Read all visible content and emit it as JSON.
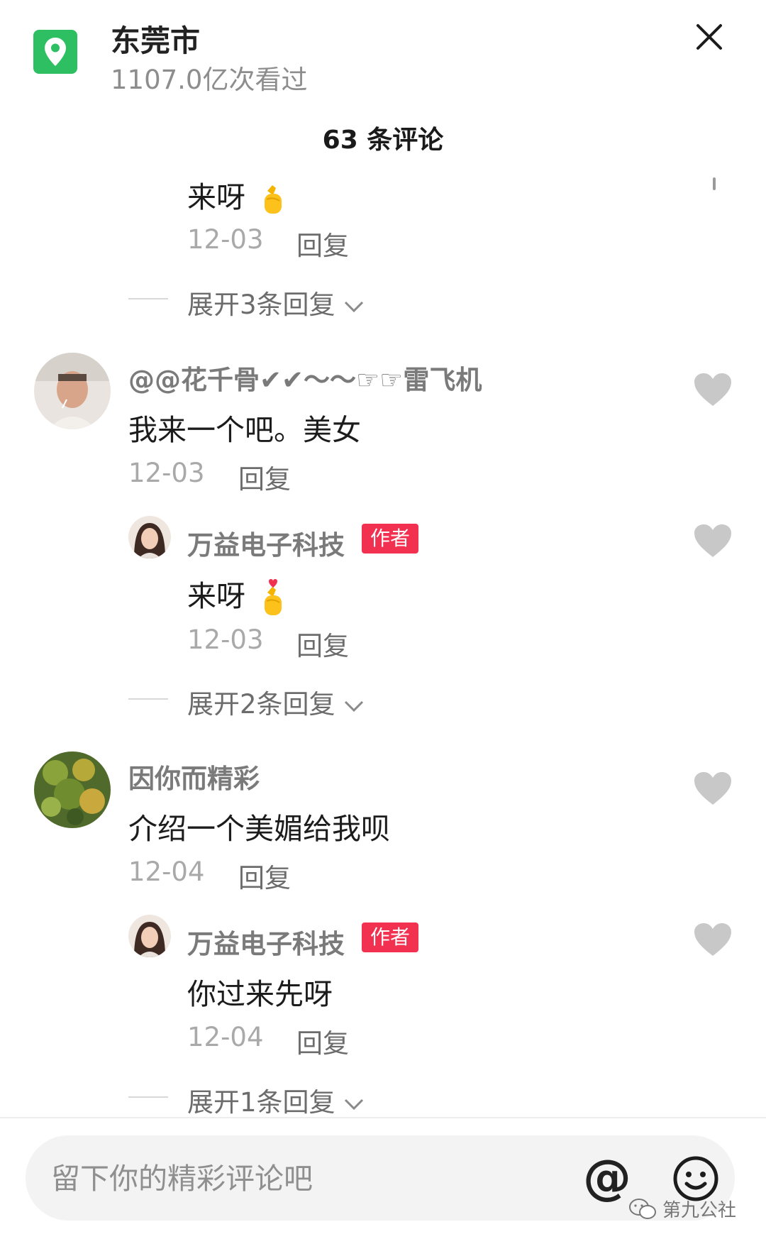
{
  "header": {
    "location_icon": "location-pin-icon",
    "location_name": "东莞市",
    "views": "1107.0亿次看过",
    "close_icon": "close-icon"
  },
  "comment_count": "63 条评论",
  "comments": [
    {
      "type": "reply",
      "text": "来呀",
      "emoji": "finger-heart-emoji",
      "date": "12-03",
      "reply_label": "回复",
      "expand_label": "展开3条回复"
    },
    {
      "type": "top",
      "username": "@@花千骨✔✔～～☞☞雷飞机",
      "text": "我来一个吧。美女",
      "date": "12-03",
      "reply_label": "回复"
    },
    {
      "type": "reply",
      "username": "万益电子科技",
      "badge": "作者",
      "text": "来呀",
      "emoji": "finger-heart-emoji",
      "date": "12-03",
      "reply_label": "回复",
      "expand_label": "展开2条回复"
    },
    {
      "type": "top",
      "username": "因你而精彩",
      "text": "介绍一个美媚给我呗",
      "date": "12-04",
      "reply_label": "回复"
    },
    {
      "type": "reply",
      "username": "万益电子科技",
      "badge": "作者",
      "text": "你过来先呀",
      "date": "12-04",
      "reply_label": "回复",
      "expand_label": "展开1条回复"
    }
  ],
  "input": {
    "placeholder": "留下你的精彩评论吧",
    "at_label": "@",
    "emoji_icon": "smiley-icon"
  },
  "watermark": "第九公社",
  "colors": {
    "location_green": "#2dbf62",
    "author_badge": "#f2304f",
    "heart_gray": "#c8c8c8"
  }
}
